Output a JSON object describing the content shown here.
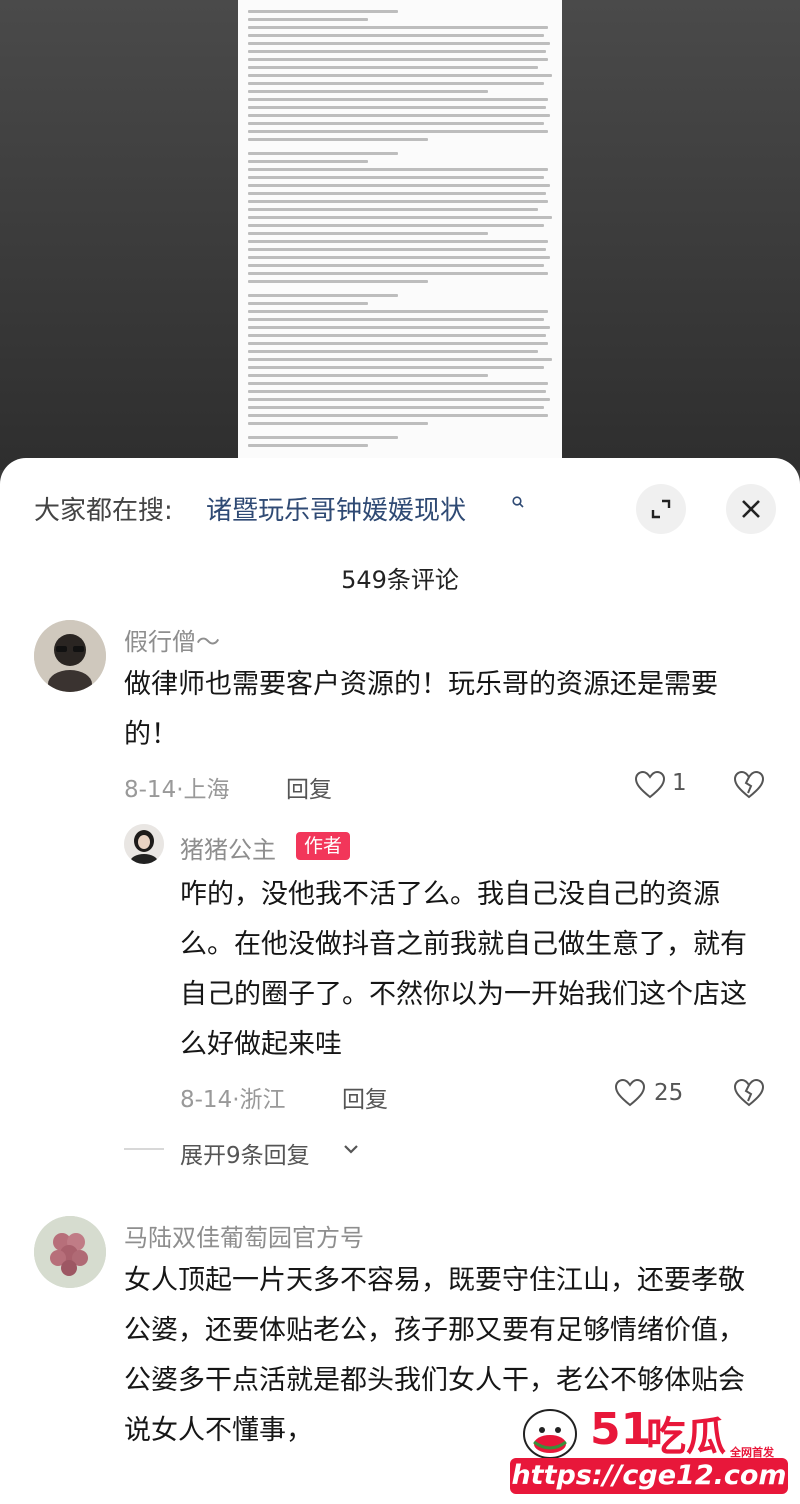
{
  "search": {
    "prefix": "大家都在搜:",
    "query": "诸暨玩乐哥钟媛媛现状"
  },
  "comments_count": "549条评论",
  "comments": [
    {
      "username": "假行僧～",
      "text": "做律师也需要客户资源的！玩乐哥的资源还是需要的！",
      "meta": "8-14·上海",
      "reply_label": "回复",
      "likes": "1"
    }
  ],
  "author_reply": {
    "username": "猪猪公主",
    "badge": "作者",
    "text": "咋的，没他我不活了么。我自己没自己的资源么。在他没做抖音之前我就自己做生意了，就有自己的圈子了。不然你以为一开始我们这个店这么好做起来哇",
    "meta": "8-14·浙江",
    "reply_label": "回复",
    "likes": "25"
  },
  "expand_label": "展开9条回复",
  "comment3": {
    "username": "马陆双佳葡萄园官方号",
    "text": "女人顶起一片天多不容易，既要守住江山，还要孝敬公婆，还要体贴老公，孩子那又要有足够情绪价值，公婆多干点活就是都头我们女人干，老公不够体贴会说女人不懂事，"
  },
  "watermark": {
    "brand_number": "51",
    "brand_text": "吃瓜",
    "tag": "全网首发",
    "url": "https://cge12.com"
  },
  "colors": {
    "accent_link": "#2f4a74",
    "author_badge": "#f2365a",
    "watermark_red": "#e8173a"
  }
}
